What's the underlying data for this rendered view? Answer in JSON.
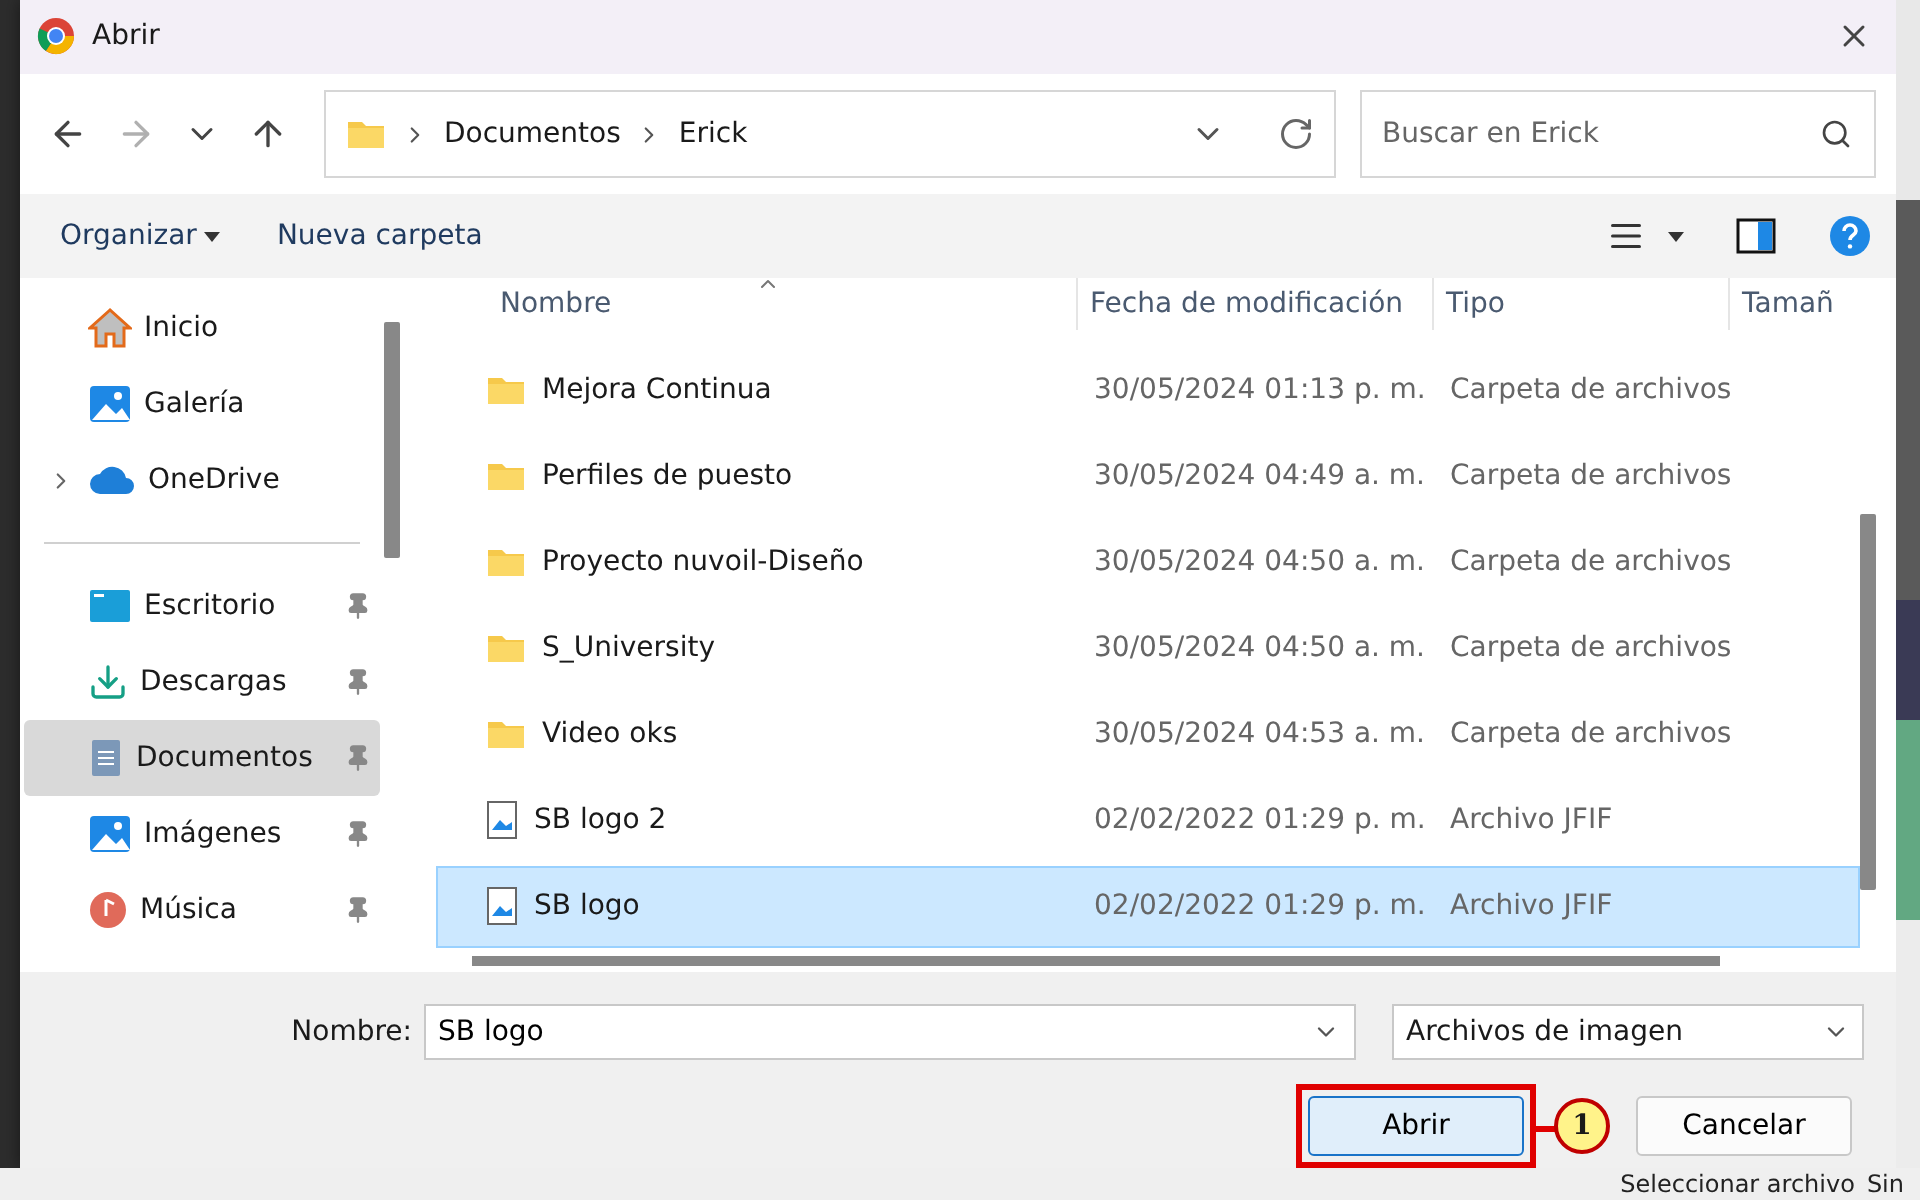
{
  "window": {
    "title": "Abrir"
  },
  "nav": {
    "back_disabled": false,
    "forward_disabled": true
  },
  "address": {
    "path": [
      "Documentos",
      "Erick"
    ]
  },
  "search": {
    "placeholder": "Buscar en Erick"
  },
  "toolbar": {
    "organize": "Organizar",
    "new_folder": "Nueva carpeta"
  },
  "sidebar": {
    "groups": [
      [
        {
          "label": "Inicio",
          "kind": "home",
          "pinned": false,
          "expandable": false,
          "selected": false
        },
        {
          "label": "Galería",
          "kind": "gallery",
          "pinned": false,
          "expandable": false,
          "selected": false
        },
        {
          "label": "OneDrive",
          "kind": "cloud",
          "pinned": false,
          "expandable": true,
          "selected": false
        }
      ],
      [
        {
          "label": "Escritorio",
          "kind": "desktop",
          "pinned": true,
          "expandable": false,
          "selected": false
        },
        {
          "label": "Descargas",
          "kind": "download",
          "pinned": true,
          "expandable": false,
          "selected": false
        },
        {
          "label": "Documentos",
          "kind": "document",
          "pinned": true,
          "expandable": false,
          "selected": true
        },
        {
          "label": "Imágenes",
          "kind": "gallery",
          "pinned": true,
          "expandable": false,
          "selected": false
        },
        {
          "label": "Música",
          "kind": "music",
          "pinned": true,
          "expandable": false,
          "selected": false
        }
      ]
    ]
  },
  "table": {
    "columns": [
      {
        "label": "Nombre",
        "sorted": true
      },
      {
        "label": "Fecha de modificación",
        "sorted": false
      },
      {
        "label": "Tipo",
        "sorted": false
      },
      {
        "label": "Tamañ",
        "sorted": false
      }
    ],
    "rows": [
      {
        "name": "Mejora Continua",
        "date": "30/05/2024 01:13 p. m.",
        "type": "Carpeta de archivos",
        "kind": "folder",
        "selected": false
      },
      {
        "name": "Perfiles de puesto",
        "date": "30/05/2024 04:49 a. m.",
        "type": "Carpeta de archivos",
        "kind": "folder",
        "selected": false
      },
      {
        "name": "Proyecto nuvoil-Diseño",
        "date": "30/05/2024 04:50 a. m.",
        "type": "Carpeta de archivos",
        "kind": "folder",
        "selected": false
      },
      {
        "name": "S_University",
        "date": "30/05/2024 04:50 a. m.",
        "type": "Carpeta de archivos",
        "kind": "folder",
        "selected": false
      },
      {
        "name": "Video oks",
        "date": "30/05/2024 04:53 a. m.",
        "type": "Carpeta de archivos",
        "kind": "folder",
        "selected": false
      },
      {
        "name": "SB logo 2",
        "date": "02/02/2022 01:29 p. m.",
        "type": "Archivo JFIF",
        "kind": "image",
        "selected": false
      },
      {
        "name": "SB logo",
        "date": "02/02/2022 01:29 p. m.",
        "type": "Archivo JFIF",
        "kind": "image",
        "selected": true
      }
    ]
  },
  "footer": {
    "name_label": "Nombre:",
    "name_value": "SB logo",
    "filter": "Archivos de imagen",
    "buttons": [
      {
        "label": "Abrir",
        "primary": true,
        "marker": "1"
      },
      {
        "label": "Cancelar",
        "primary": false
      }
    ]
  },
  "background": {
    "texts": [
      "Seleccionar archivo",
      "Sin"
    ]
  }
}
